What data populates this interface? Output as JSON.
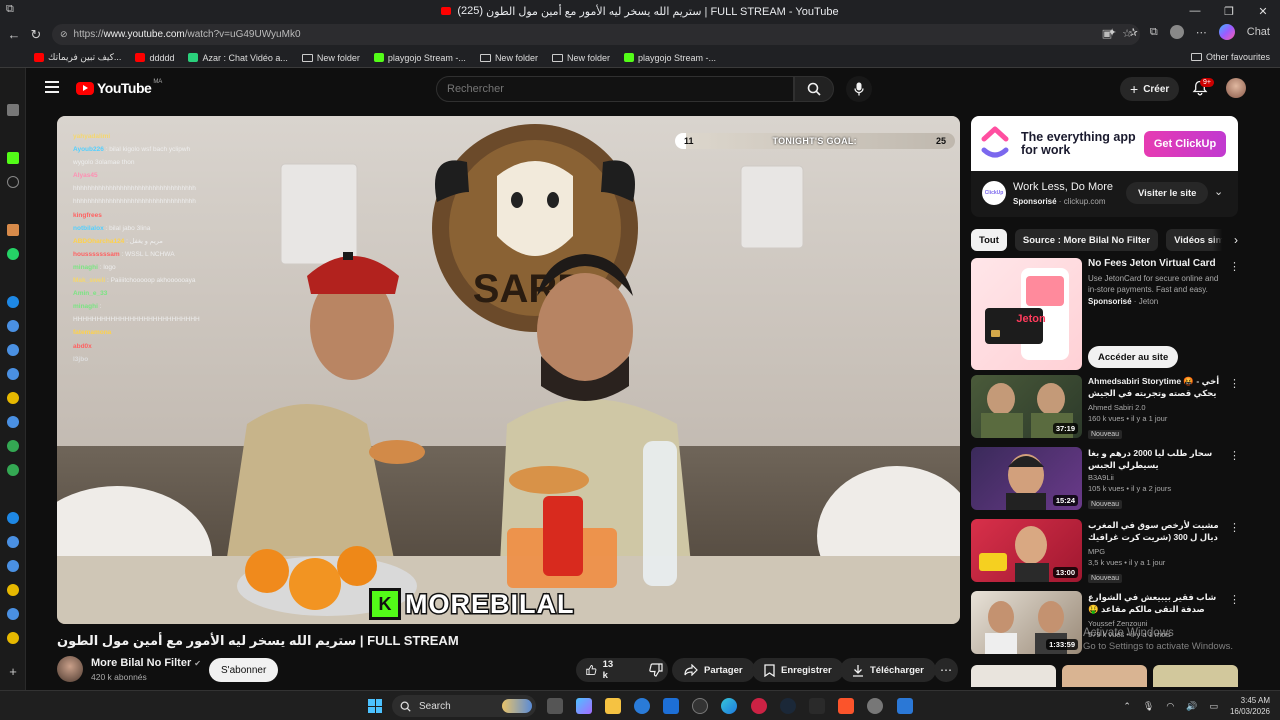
{
  "browser": {
    "tab_count": "(225)",
    "window_title": "ستريم الله يسخر ليه الأمور مع أمين مول الطون | FULL STREAM - YouTube",
    "url_prefix": "https://",
    "url_host": "www.youtube.com",
    "url_path": "/watch?v=uG49UWyuMk0",
    "chat_label": "Chat",
    "bookmarks": [
      "كيف تبين فريماتك...",
      "ddddd",
      "Azar : Chat Vidéo a...",
      "New folder",
      "playgojo Stream -...",
      "New folder",
      "New folder",
      "playgojo Stream -..."
    ],
    "other_favourites": "Other favourites"
  },
  "youtube": {
    "logo_text": "YouTube",
    "logo_region": "MA",
    "search_placeholder": "Rechercher",
    "create_label": "Créer",
    "notif_count": "9+"
  },
  "video": {
    "goal_left": "11",
    "goal_label": "TONIGHT'S GOAL:",
    "goal_right": "25",
    "overlay_letter": "K",
    "overlay_name": "MOREBILAL",
    "chat": [
      {
        "name": "yahyadalimi",
        "msg": ""
      },
      {
        "name": "Ayoub226",
        "msg": ": bilal kigolo wsf bach yclipwh"
      },
      {
        "name": "",
        "msg": "wygolo 3olamae thon"
      },
      {
        "name": "Alyas45",
        "msg": ""
      },
      {
        "name": "",
        "msg": "hhhhhhhhhhhhhhhhhhhhhhhhhhhhhhhhhh"
      },
      {
        "name": "",
        "msg": "hhhhhhhhhhhhhhhhhhhhhhhhhhhhhhhhhh"
      },
      {
        "name": "kingfrees",
        "msg": ""
      },
      {
        "name": "notbilalox",
        "msg": ": bilal jabo 3lina"
      },
      {
        "name": "ABDOharcha124",
        "msg": ": مريم و يغفل"
      },
      {
        "name": "housssssssam",
        "msg": ": WSSL L NCHWA"
      },
      {
        "name": "minaghi",
        "msg": ": logo"
      },
      {
        "name": "Mak_sweli",
        "msg": ": Paiiiitchooooop akhoooooaya"
      },
      {
        "name": "Amin_e_33",
        "msg": ""
      },
      {
        "name": "minaghi",
        "msg": ":"
      },
      {
        "name": "",
        "msg": "HHHHHHHHHHHHHHHHHHHHHHHHHHH"
      },
      {
        "name": "fatemamona",
        "msg": ""
      },
      {
        "name": "abd0x",
        "msg": ""
      },
      {
        "name": "l3jbo",
        "msg": ""
      }
    ]
  },
  "watch": {
    "title": "ستريم الله يسخر ليه الأمور مع أمين مول الطون | FULL STREAM",
    "channel": "More Bilal No Filter",
    "verified": "✔",
    "subscribers": "420 k abonnés",
    "subscribe_label": "S'abonner",
    "likes": "13 k",
    "share_label": "Partager",
    "save_label": "Enregistrer",
    "download_label": "Télécharger"
  },
  "ad": {
    "headline": "The everything app for work",
    "cta": "Get ClickUp",
    "icon_text": "ClickUp",
    "title": "Work Less, Do More",
    "sponsored": "Sponsorisé",
    "domain": "clickup.com",
    "visit_label": "Visiter le site"
  },
  "chips": [
    "Tout",
    "Source : More Bilal No Filter",
    "Vidéos similaires"
  ],
  "jeton": {
    "title": "No Fees Jeton Virtual Card",
    "desc": "Use JetonCard for secure online and in-store payments. Fast and easy.",
    "sponsored": "Sponsorisé",
    "brand": "Jeton",
    "cta": "Accéder au site",
    "card_text": "Jeton"
  },
  "recs": [
    {
      "title": "Ahmedsabiri Storytime 🤬 - أخي يحكي قصته وتجربته في الجيش شاف جنون",
      "channel": "Ahmed Sabiri 2.0",
      "meta": "160 k vues • il y a 1 jour",
      "duration": "37:19",
      "badge": "Nouveau"
    },
    {
      "title": "سحار طلب ليا 2000 درهم و بغا يسيطرلي الجبس",
      "channel": "B3A9Lii",
      "meta": "105 k vues • il y a 2 jours",
      "duration": "15:24",
      "badge": "Nouveau"
    },
    {
      "title": "مشيت لأرخص سوق في المغرب ديال ل 300 (شريت كرت غرافيك ب GAMIN...",
      "channel": "MPG",
      "meta": "3,5 k vues • il y a 1 jour",
      "duration": "13:00",
      "badge": "Nouveau"
    },
    {
      "title": "شاب فقير بيبيعش في الشوارع صدفة التقى مالكم مقاعد 🤑 قام بتدريبه للفوز بلقب بطل",
      "channel": "Youssef Zenzouni",
      "meta": "579 k vues • il y a 1 mois",
      "duration": "1:33:59",
      "badge": ""
    }
  ],
  "activation": {
    "line1": "Activate Windows",
    "line2": "Go to Settings to activate Windows."
  },
  "taskbar": {
    "search_label": "Search",
    "time": "3:45 AM",
    "date": "16/03/2026"
  }
}
